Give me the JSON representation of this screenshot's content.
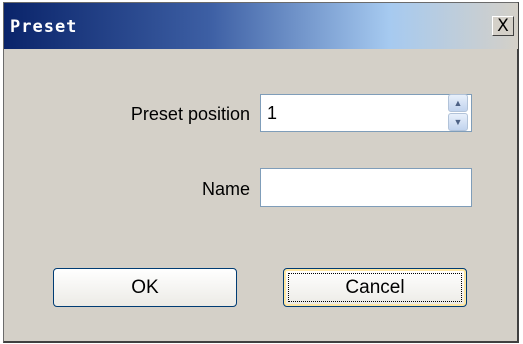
{
  "dialog": {
    "title": "Preset",
    "close_glyph": "X",
    "preset_position_label": "Preset position",
    "preset_position_value": "1",
    "name_label": "Name",
    "name_value": "",
    "spin_up_glyph": "▲",
    "spin_down_glyph": "▼",
    "ok_label": "OK",
    "cancel_label": "Cancel"
  }
}
